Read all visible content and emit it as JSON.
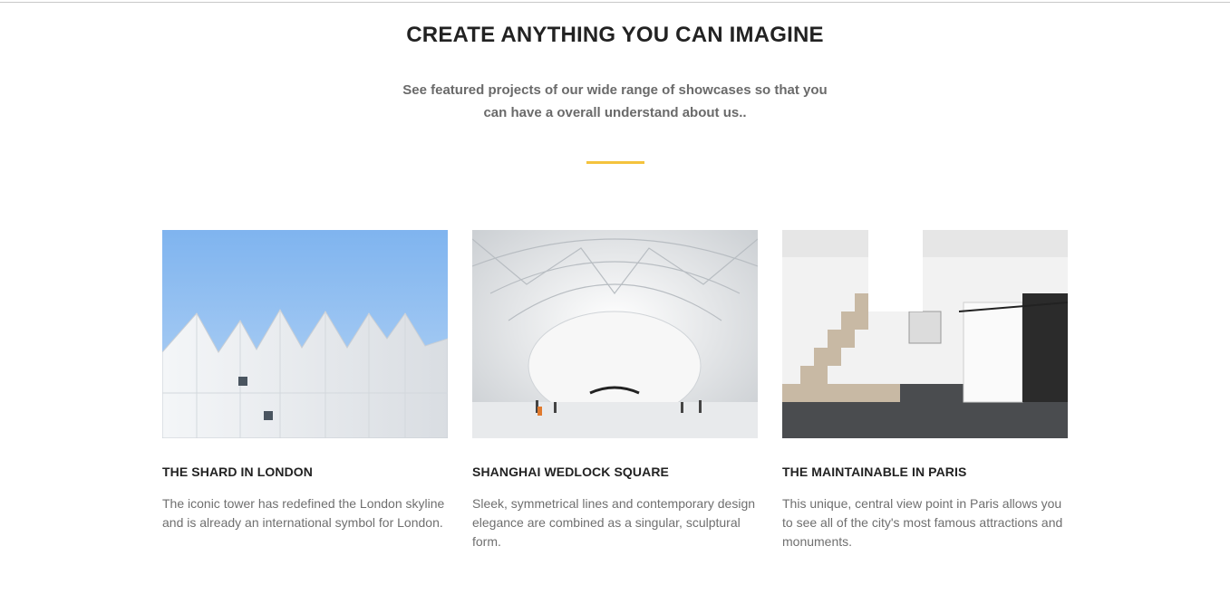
{
  "section": {
    "title": "CREATE ANYTHING YOU CAN IMAGINE",
    "subtitle_line1": "See featured projects of our wide range of showcases so that you",
    "subtitle_line2": "can have a overall understand about us..",
    "accent_color": "#f4c33d"
  },
  "projects": [
    {
      "title": "THE SHARD IN LONDON",
      "text": "The iconic tower has redefined the London skyline and is already an international symbol for London.",
      "image": "white-gabled-building-photo"
    },
    {
      "title": "SHANGHAI WEDLOCK SQUARE",
      "text": "Sleek, symmetrical lines and contemporary design elegance are combined as a singular, sculptural form.",
      "image": "white-curved-hall-photo"
    },
    {
      "title": "THE MAINTAINABLE IN PARIS",
      "text": "This unique, central view point in Paris allows you to see all of the city's most famous attractions and monuments.",
      "image": "white-loft-staircase-photo"
    }
  ]
}
